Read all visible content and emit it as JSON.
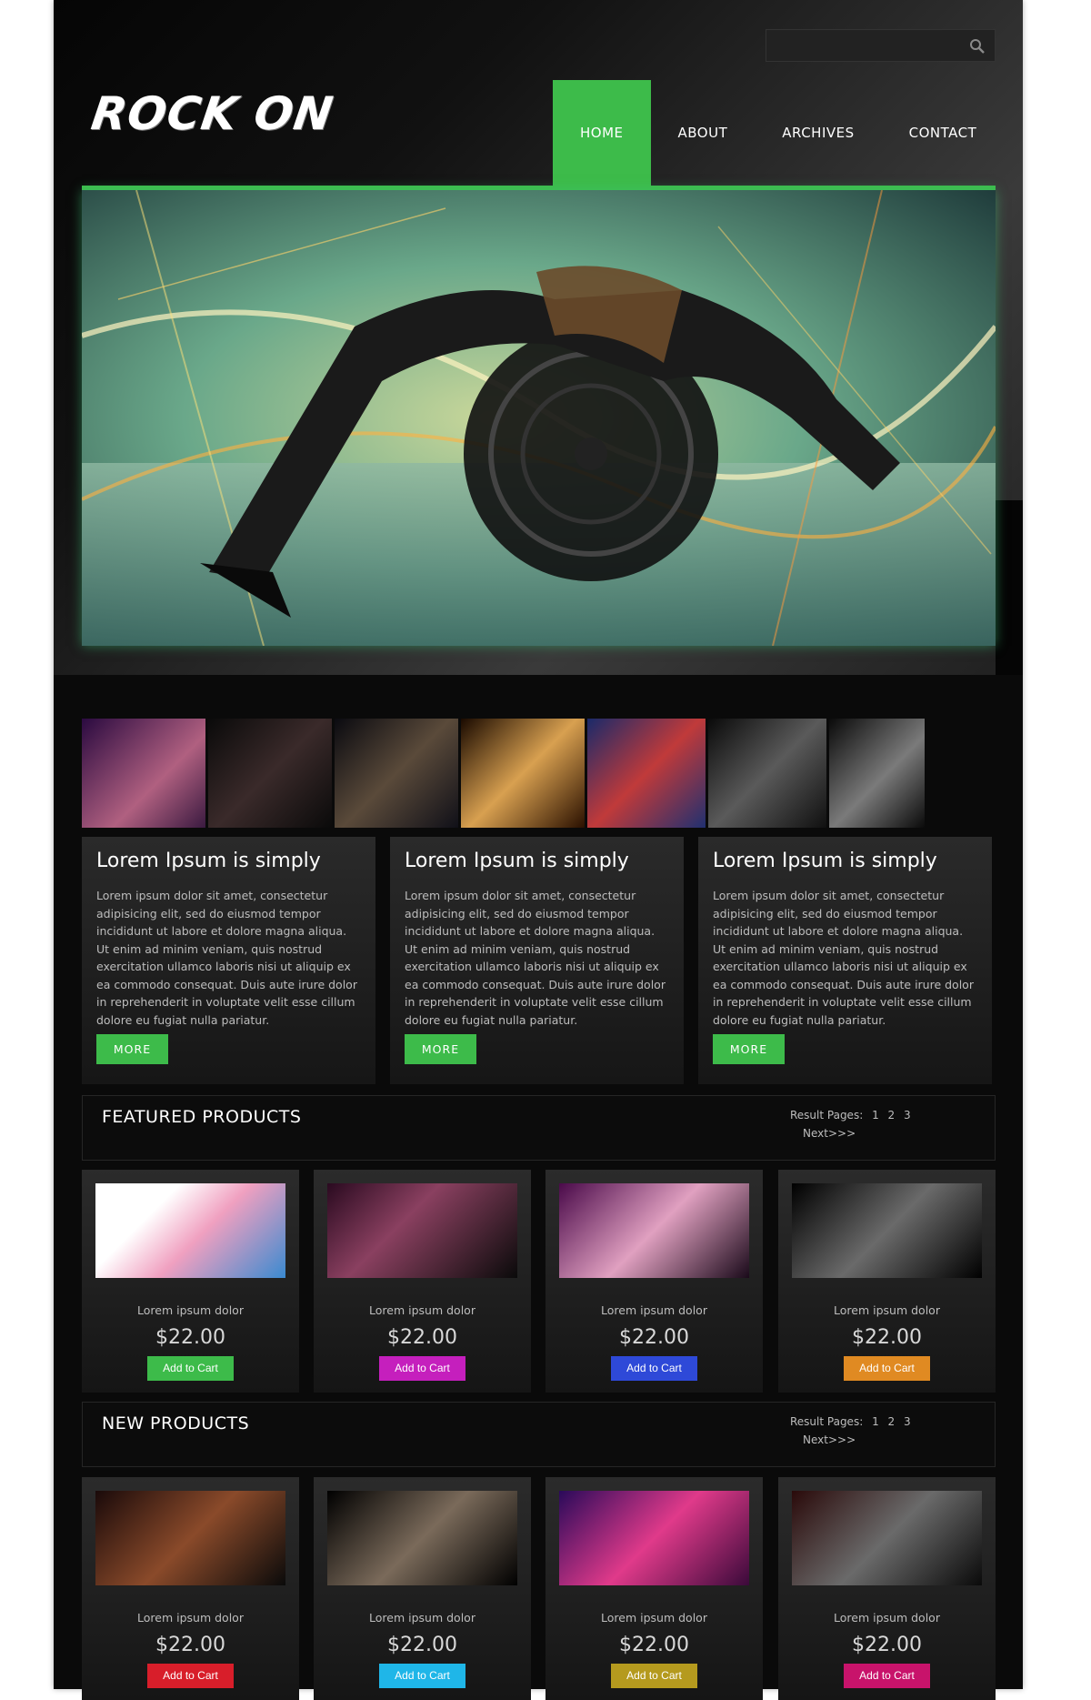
{
  "brand": {
    "logo": "ROCK ON",
    "accent": "#3dbb4a"
  },
  "search": {
    "placeholder": ""
  },
  "nav": {
    "items": [
      {
        "label": "HOME",
        "active": true
      },
      {
        "label": "ABOUT",
        "active": false
      },
      {
        "label": "ARCHIVES",
        "active": false
      },
      {
        "label": "CONTACT",
        "active": false
      }
    ]
  },
  "columns": [
    {
      "title": "Lorem Ipsum is simply",
      "body": "Lorem ipsum dolor sit amet, consectetur adipisicing elit, sed do eiusmod tempor incididunt ut labore et dolore magna aliqua. Ut enim ad minim veniam, quis nostrud exercitation ullamco laboris nisi ut aliquip ex ea commodo consequat. Duis aute irure dolor in reprehenderit in voluptate velit esse cillum dolore eu fugiat nulla pariatur.",
      "button": "MORE"
    },
    {
      "title": "Lorem Ipsum is simply",
      "body": "Lorem ipsum dolor sit amet, consectetur adipisicing elit, sed do eiusmod tempor incididunt ut labore et dolore magna aliqua. Ut enim ad minim veniam, quis nostrud exercitation ullamco laboris nisi ut aliquip ex ea commodo consequat. Duis aute irure dolor in reprehenderit in voluptate velit esse cillum dolore eu fugiat nulla pariatur.",
      "button": "MORE"
    },
    {
      "title": "Lorem Ipsum is simply",
      "body": "Lorem ipsum dolor sit amet, consectetur adipisicing elit, sed do eiusmod tempor incididunt ut labore et dolore magna aliqua. Ut enim ad minim veniam, quis nostrud exercitation ullamco laboris nisi ut aliquip ex ea commodo consequat. Duis aute irure dolor in reprehenderit in voluptate velit esse cillum dolore eu fugiat nulla pariatur.",
      "button": "MORE"
    }
  ],
  "featured": {
    "title": "FEATURED PRODUCTS",
    "pager": {
      "label": "Result Pages:",
      "pages": [
        "1",
        "2",
        "3"
      ],
      "next": "Next>>>"
    },
    "products": [
      {
        "name": "Lorem ipsum dolor",
        "price": "$22.00",
        "cart": "Add to Cart",
        "color": "#3dbb4a"
      },
      {
        "name": "Lorem ipsum dolor",
        "price": "$22.00",
        "cart": "Add to Cart",
        "color": "#c51fbd"
      },
      {
        "name": "Lorem ipsum dolor",
        "price": "$22.00",
        "cart": "Add to Cart",
        "color": "#2e49d8"
      },
      {
        "name": "Lorem ipsum dolor",
        "price": "$22.00",
        "cart": "Add to Cart",
        "color": "#e08a22"
      }
    ]
  },
  "newprod": {
    "title": "NEW PRODUCTS",
    "pager": {
      "label": "Result Pages:",
      "pages": [
        "1",
        "2",
        "3"
      ],
      "next": "Next>>>"
    },
    "products": [
      {
        "name": "Lorem ipsum dolor",
        "price": "$22.00",
        "cart": "Add to Cart",
        "color": "#d81e2a"
      },
      {
        "name": "Lorem ipsum dolor",
        "price": "$22.00",
        "cart": "Add to Cart",
        "color": "#1fb6e8"
      },
      {
        "name": "Lorem ipsum dolor",
        "price": "$22.00",
        "cart": "Add to Cart",
        "color": "#b59a1e"
      },
      {
        "name": "Lorem ipsum dolor",
        "price": "$22.00",
        "cart": "Add to Cart",
        "color": "#c8136b"
      }
    ]
  }
}
